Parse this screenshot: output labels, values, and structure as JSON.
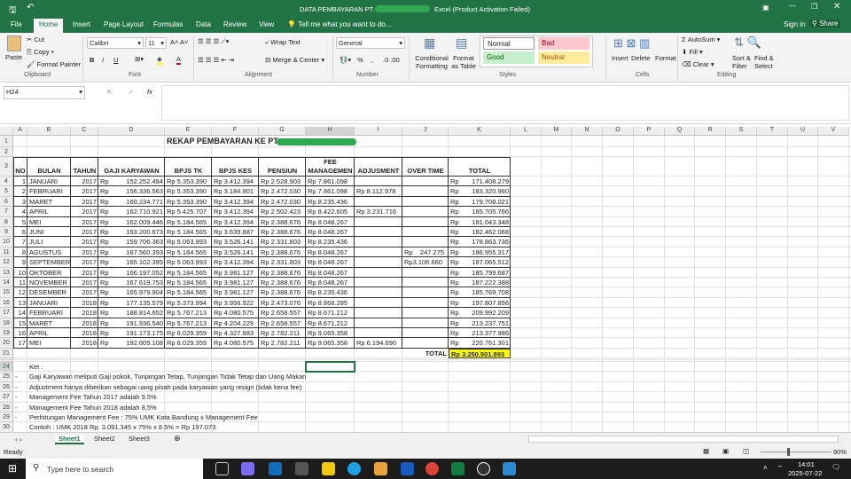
{
  "window": {
    "title": "DATA PEMBAYARAN PT.",
    "app_suffix": "Excel (Product Activation Failed)",
    "sign_in": "Sign in",
    "share": "Share"
  },
  "ribbon_tabs": [
    "File",
    "Home",
    "Insert",
    "Page Layout",
    "Formulas",
    "Data",
    "Review",
    "View"
  ],
  "tell_me": "Tell me what you want to do...",
  "clipboard": {
    "paste": "Paste",
    "cut": "Cut",
    "copy": "Copy",
    "format_painter": "Format Painter",
    "group": "Clipboard"
  },
  "font": {
    "name": "Calibri",
    "size": "11",
    "bold": "B",
    "italic": "I",
    "underline": "U",
    "group": "Font"
  },
  "alignment": {
    "wrap": "Wrap Text",
    "merge": "Merge & Center",
    "group": "Alignment"
  },
  "number": {
    "format": "General",
    "percent": "%",
    "comma": ",",
    "group": "Number"
  },
  "styles": {
    "conditional": "Conditional Formatting",
    "format_table": "Format as Table",
    "normal": "Normal",
    "bad": "Bad",
    "good": "Good",
    "neutral": "Neutral",
    "group": "Styles"
  },
  "cells": {
    "insert": "Insert",
    "delete": "Delete",
    "format": "Format",
    "group": "Cells"
  },
  "editing": {
    "autosum": "AutoSum",
    "fill": "Fill",
    "clear": "Clear",
    "sort": "Sort & Filter",
    "find": "Find & Select",
    "group": "Editing"
  },
  "formula_bar": {
    "name_box": "H24",
    "fx": "fx",
    "value": ""
  },
  "columns": [
    "A",
    "B",
    "C",
    "D",
    "E",
    "F",
    "G",
    "H",
    "I",
    "J",
    "K",
    "L",
    "M",
    "N",
    "O",
    "P",
    "Q",
    "R",
    "S",
    "T",
    "U",
    "V"
  ],
  "sheet": {
    "title": "REKAP PEMBAYARAN KE PT.",
    "headers": [
      "NO",
      "BULAN",
      "TAHUN",
      "GAJI KARYAWAN",
      "BPJS TK",
      "BPJS KES",
      "PENSIUN",
      "FEE MANAGEMEN",
      "ADJUSMENT",
      "OVER TIME",
      "TOTAL"
    ],
    "rows": [
      [
        "1",
        "JANUARI",
        "2017",
        "152.252.494",
        "Rp 5.353.390",
        "Rp 3.412.394",
        "Rp 2.528.903",
        "Rp 7.861.098",
        "",
        "",
        "171.408.279"
      ],
      [
        "2",
        "FEBRUARI",
        "2017",
        "156.336.563",
        "Rp 5.353.390",
        "Rp 3.184.901",
        "Rp 2.472.030",
        "Rp 7.861.098",
        "Rp 8.112.978",
        "",
        "183.320.960"
      ],
      [
        "3",
        "MARET",
        "2017",
        "160.234.771",
        "Rp 5.353.390",
        "Rp 3.412.394",
        "Rp 2.472.030",
        "Rp 8.235.436",
        "",
        "",
        "179.708.021"
      ],
      [
        "4",
        "APRIL",
        "2017",
        "162.710.921",
        "Rp 5.425.707",
        "Rp 3.412.394",
        "Rp 2.502.423",
        "Rp 8.422.605",
        "Rp 3.231.716",
        "",
        "185.705.766"
      ],
      [
        "5",
        "MEI",
        "2017",
        "162.009.446",
        "Rp 5.184.565",
        "Rp 3.412.394",
        "Rp 2.388.676",
        "Rp 8.048.267",
        "",
        "",
        "181.043.348"
      ],
      [
        "6",
        "JUNI",
        "2017",
        "163.200.673",
        "Rp 5.184.565",
        "Rp 3.639.887",
        "Rp 2.388.676",
        "Rp 8.048.267",
        "",
        "",
        "182.462.068"
      ],
      [
        "7",
        "JULI",
        "2017",
        "159.706.363",
        "Rp 5.063.993",
        "Rp 3.526.141",
        "Rp 2.331.803",
        "Rp 8.235.436",
        "",
        "",
        "178.863.736"
      ],
      [
        "8",
        "AGUSTUS",
        "2017",
        "167.560.393",
        "Rp 5.184.565",
        "Rp 3.526.141",
        "Rp 2.388.676",
        "Rp 8.048.267",
        "",
        "Rp    247.275",
        "186.955.317"
      ],
      [
        "9",
        "SEPTEMBER",
        "2017",
        "165.102.395",
        "Rp 5.063.993",
        "Rp 3.412.394",
        "Rp 2.331.803",
        "Rp 8.048.267",
        "",
        "Rp3.106.660",
        "187.065.512"
      ],
      [
        "10",
        "OKTOBER",
        "2017",
        "166.197.052",
        "Rp 5.184.565",
        "Rp 3.981.127",
        "Rp 2.388.676",
        "Rp 8.048.267",
        "",
        "",
        "185.799.687"
      ],
      [
        "11",
        "NOVEMBER",
        "2017",
        "167.619.753",
        "Rp 5.184.565",
        "Rp 3.981.127",
        "Rp 2.388.676",
        "Rp 8.048.267",
        "",
        "",
        "187.222.388"
      ],
      [
        "12",
        "DESEMBER",
        "2017",
        "165.979.904",
        "Rp 5.184.565",
        "Rp 3.981.127",
        "Rp 2.388.676",
        "Rp 8.235.436",
        "",
        "",
        "185.769.708"
      ],
      [
        "13",
        "JANUARI",
        "2018",
        "177.135.579",
        "Rp 5.373.994",
        "Rp 3.956.922",
        "Rp 2.473.076",
        "Rp 8.868.285",
        "",
        "",
        "197.807.856"
      ],
      [
        "14",
        "FEBRUARI",
        "2018",
        "188.814.652",
        "Rp 5.767.213",
        "Rp 4.080.575",
        "Rp 2.658.557",
        "Rp 8.671.212",
        "",
        "",
        "209.992.209"
      ],
      [
        "15",
        "MARET",
        "2018",
        "191.936.540",
        "Rp 5.767.213",
        "Rp 4.204.229",
        "Rp 2.658.557",
        "Rp 8.671.212",
        "",
        "",
        "213.237.751"
      ],
      [
        "16",
        "APRIL",
        "2018",
        "191.173.175",
        "Rp 6.029.359",
        "Rp 4.327.883",
        "Rp 2.782.211",
        "Rp 9.065.358",
        "",
        "",
        "213.377.986"
      ],
      [
        "17",
        "MEI",
        "2018",
        "192.609.108",
        "Rp 6.029.359",
        "Rp 4.080.575",
        "Rp 2.782.211",
        "Rp 9.065.358",
        "Rp 6.194.690",
        "",
        "220.761.301"
      ]
    ],
    "currency": "Rp",
    "total_label": "TOTAL",
    "total_value": "Rp 3.250.501.893",
    "notes_title": "Ket :",
    "bullet": "-",
    "notes": [
      "Gaji Karyawan meliputi Gaji pokok, Tunjangan Tetap, Tunjangan Tidak Tetap dan Uang Makan",
      "Adjustment hanya diberikan sebagai uang pisah pada karyawan yang resign (tidak kena fee)",
      "Management Fee Tahun 2017 adalah 9.5%",
      "Management Fee Tahun 2018 adalah 8,5%",
      "Perhitungan Management Fee : 75% UMK Kota Bandung x Management Fee",
      "Contoh : UMK 2018 Rp. 3.091.345 x 75%  x 8.5% = Rp 197.073"
    ],
    "total_fill": "#ffff00"
  },
  "sheet_tabs": [
    "Sheet1",
    "Sheet2",
    "Sheet3"
  ],
  "status": {
    "ready": "Ready",
    "zoom": "90%"
  },
  "taskbar": {
    "search": "Type here to search",
    "time": "14:01",
    "date": "2025-07-22"
  }
}
